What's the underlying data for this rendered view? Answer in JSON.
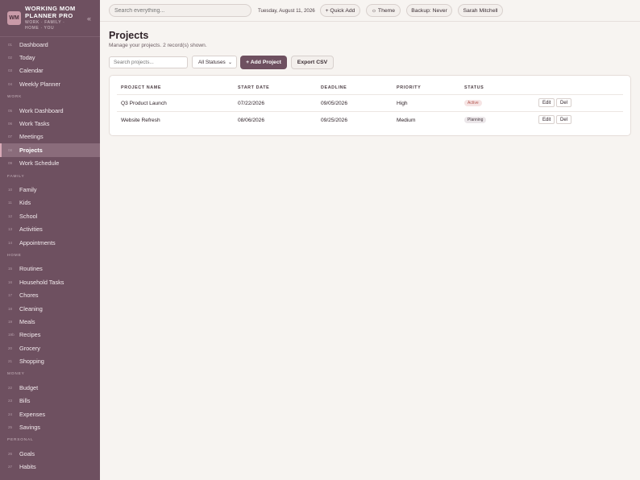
{
  "brand": {
    "logo": "WM",
    "name_line1": "WORKING MOM",
    "name_line2": "PLANNER PRO",
    "sub_line1": "WORK · FAMILY ·",
    "sub_line2": "HOME · YOU",
    "collapse_icon": "«"
  },
  "nav": {
    "dashboard": {
      "num": "01",
      "label": "Dashboard"
    },
    "today": {
      "num": "02",
      "label": "Today"
    },
    "calendar": {
      "num": "03",
      "label": "Calendar"
    },
    "weekly": {
      "num": "04",
      "label": "Weekly Planner"
    },
    "section_work": "WORK",
    "work_dashboard": {
      "num": "05",
      "label": "Work Dashboard"
    },
    "work_tasks": {
      "num": "06",
      "label": "Work Tasks"
    },
    "meetings": {
      "num": "07",
      "label": "Meetings"
    },
    "projects": {
      "num": "08",
      "label": "Projects"
    },
    "work_schedule": {
      "num": "09",
      "label": "Work Schedule"
    },
    "section_family": "FAMILY",
    "family": {
      "num": "10",
      "label": "Family"
    },
    "kids": {
      "num": "11",
      "label": "Kids"
    },
    "school": {
      "num": "12",
      "label": "School"
    },
    "activities": {
      "num": "13",
      "label": "Activities"
    },
    "appointments": {
      "num": "14",
      "label": "Appointments"
    },
    "section_home": "HOME",
    "routines": {
      "num": "15",
      "label": "Routines"
    },
    "household": {
      "num": "16",
      "label": "Household Tasks"
    },
    "chores": {
      "num": "17",
      "label": "Chores"
    },
    "cleaning": {
      "num": "18",
      "label": "Cleaning"
    },
    "meals": {
      "num": "19",
      "label": "Meals"
    },
    "recipes": {
      "num": "19b",
      "label": "Recipes"
    },
    "grocery": {
      "num": "20",
      "label": "Grocery"
    },
    "shopping": {
      "num": "21",
      "label": "Shopping"
    },
    "section_money": "MONEY",
    "budget": {
      "num": "22",
      "label": "Budget"
    },
    "bills": {
      "num": "23",
      "label": "Bills"
    },
    "expenses": {
      "num": "24",
      "label": "Expenses"
    },
    "savings": {
      "num": "25",
      "label": "Savings"
    },
    "section_personal": "PERSONAL",
    "goals": {
      "num": "26",
      "label": "Goals"
    },
    "habits": {
      "num": "27",
      "label": "Habits"
    }
  },
  "topbar": {
    "search_placeholder": "Search everything...",
    "date": "Tuesday, August 11, 2026",
    "quick_add": "+ Quick Add",
    "theme": "☼ Theme",
    "backup": "Backup: Never",
    "user": "Sarah Mitchell"
  },
  "page": {
    "title": "Projects",
    "subtitle": "Manage your projects. 2 record(s) shown.",
    "search_placeholder": "Search projects...",
    "status_filter": "All Statuses",
    "add_button": "+ Add Project",
    "export_button": "Export CSV"
  },
  "table": {
    "headers": {
      "name": "PROJECT NAME",
      "start": "START DATE",
      "deadline": "DEADLINE",
      "priority": "PRIORITY",
      "status": "STATUS"
    },
    "rows": [
      {
        "name": "Q3 Product Launch",
        "start": "07/22/2026",
        "deadline": "09/05/2026",
        "priority": "High",
        "status": "Active",
        "edit": "Edit",
        "del": "Del"
      },
      {
        "name": "Website Refresh",
        "start": "08/06/2026",
        "deadline": "09/25/2026",
        "priority": "Medium",
        "status": "Planning",
        "edit": "Edit",
        "del": "Del"
      }
    ]
  },
  "colors": {
    "sidebar_bg": "#6e5060",
    "accent": "#6e5060",
    "active_badge": "#b2564f"
  }
}
